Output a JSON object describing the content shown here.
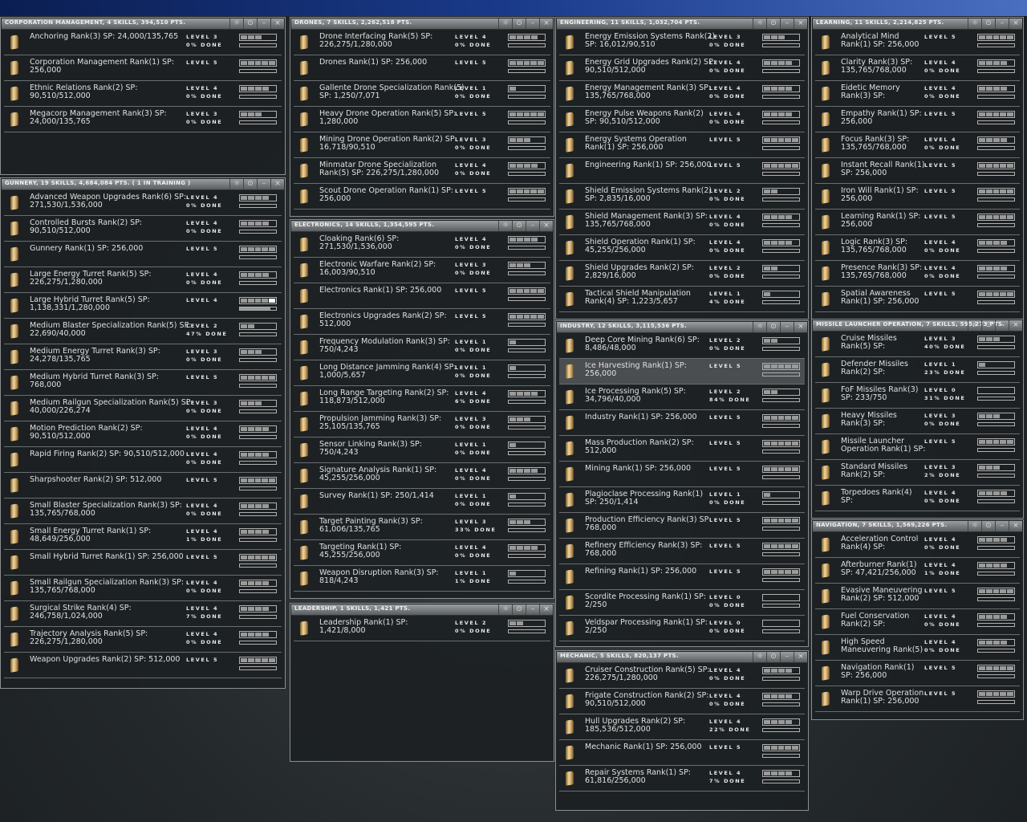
{
  "windows": [
    {
      "id": "corporation-management",
      "title": "CORPORATION MANAGEMENT, 4 SKILLS, 394,510 PTS.",
      "skills": [
        {
          "n": "Anchoring Rank(3) SP: 24,000/135,765",
          "s": "",
          "l": "LEVEL 3",
          "d": "0% DONE",
          "v": 3
        },
        {
          "n": "Corporation Management Rank(1) SP:",
          "s": "256,000",
          "l": "LEVEL 5",
          "d": "",
          "v": 5
        },
        {
          "n": "Ethnic Relations Rank(2) SP:",
          "s": "90,510/512,000",
          "l": "LEVEL 4",
          "d": "0% DONE",
          "v": 4
        },
        {
          "n": "Megacorp Management Rank(3) SP:",
          "s": "24,000/135,765",
          "l": "LEVEL 3",
          "d": "0% DONE",
          "v": 3
        }
      ]
    },
    {
      "id": "gunnery",
      "title": "GUNNERY, 19 SKILLS, 4,684,084 PTS. ( 1 IN TRAINING )",
      "skills": [
        {
          "n": "Advanced Weapon Upgrades Rank(6) SP:",
          "s": "271,530/1,536,000",
          "l": "LEVEL 4",
          "d": "0% DONE",
          "v": 4
        },
        {
          "n": "Controlled Bursts Rank(2) SP:",
          "s": "90,510/512,000",
          "l": "LEVEL 4",
          "d": "0% DONE",
          "v": 4
        },
        {
          "n": "Gunnery Rank(1) SP: 256,000",
          "s": "",
          "l": "LEVEL 5",
          "d": "",
          "v": 5
        },
        {
          "n": "Large Energy Turret Rank(5) SP:",
          "s": "226,275/1,280,000",
          "l": "LEVEL 4",
          "d": "0% DONE",
          "v": 4
        },
        {
          "n": "Large Hybrid Turret Rank(5) SP:",
          "s": "1,138,331/1,280,000",
          "l": "LEVEL 4",
          "d": "",
          "v": 4,
          "training": true,
          "progress": 0.85
        },
        {
          "n": "Medium Blaster Specialization Rank(5) SP:",
          "s": "22,690/40,000",
          "l": "LEVEL 2",
          "d": "47% DONE",
          "v": 2
        },
        {
          "n": "Medium Energy Turret Rank(3) SP:",
          "s": "24,278/135,765",
          "l": "LEVEL 3",
          "d": "0% DONE",
          "v": 3
        },
        {
          "n": "Medium Hybrid Turret Rank(3) SP:",
          "s": "768,000",
          "l": "LEVEL 5",
          "d": "",
          "v": 5
        },
        {
          "n": "Medium Railgun Specialization Rank(5) SP:",
          "s": "40,000/226,274",
          "l": "LEVEL 3",
          "d": "0% DONE",
          "v": 3
        },
        {
          "n": "Motion Prediction Rank(2) SP:",
          "s": "90,510/512,000",
          "l": "LEVEL 4",
          "d": "0% DONE",
          "v": 4
        },
        {
          "n": "Rapid Firing Rank(2) SP: 90,510/512,000",
          "s": "",
          "l": "LEVEL 4",
          "d": "0% DONE",
          "v": 4
        },
        {
          "n": "Sharpshooter Rank(2) SP: 512,000",
          "s": "",
          "l": "LEVEL 5",
          "d": "",
          "v": 5
        },
        {
          "n": "Small Blaster Specialization Rank(3) SP:",
          "s": "135,765/768,000",
          "l": "LEVEL 4",
          "d": "0% DONE",
          "v": 4
        },
        {
          "n": "Small Energy Turret Rank(1) SP:",
          "s": "48,649/256,000",
          "l": "LEVEL 4",
          "d": "1% DONE",
          "v": 4
        },
        {
          "n": "Small Hybrid Turret Rank(1) SP: 256,000",
          "s": "",
          "l": "LEVEL 5",
          "d": "",
          "v": 5
        },
        {
          "n": "Small Railgun Specialization Rank(3) SP:",
          "s": "135,765/768,000",
          "l": "LEVEL 4",
          "d": "0% DONE",
          "v": 4
        },
        {
          "n": "Surgical Strike Rank(4) SP:",
          "s": "246,758/1,024,000",
          "l": "LEVEL 4",
          "d": "7% DONE",
          "v": 4
        },
        {
          "n": "Trajectory Analysis Rank(5) SP:",
          "s": "226,275/1,280,000",
          "l": "LEVEL 4",
          "d": "0% DONE",
          "v": 4
        },
        {
          "n": "Weapon Upgrades Rank(2) SP: 512,000",
          "s": "",
          "l": "LEVEL 5",
          "d": "",
          "v": 5
        }
      ]
    },
    {
      "id": "drones",
      "title": "DRONES, 7 SKILLS, 2,262,518 PTS.",
      "skills": [
        {
          "n": "Drone Interfacing Rank(5) SP:",
          "s": "226,275/1,280,000",
          "l": "LEVEL 4",
          "d": "0% DONE",
          "v": 4
        },
        {
          "n": "Drones Rank(1) SP: 256,000",
          "s": "",
          "l": "LEVEL 5",
          "d": "",
          "v": 5
        },
        {
          "n": "Gallente Drone Specialization Rank(5)",
          "s": "SP: 1,250/7,071",
          "l": "LEVEL 1",
          "d": "0% DONE",
          "v": 1
        },
        {
          "n": "Heavy Drone Operation Rank(5) SP:",
          "s": "1,280,000",
          "l": "LEVEL 5",
          "d": "",
          "v": 5
        },
        {
          "n": "Mining Drone Operation Rank(2) SP:",
          "s": "16,718/90,510",
          "l": "LEVEL 3",
          "d": "0% DONE",
          "v": 3
        },
        {
          "n": "Minmatar Drone Specialization",
          "s": "Rank(5) SP: 226,275/1,280,000",
          "l": "LEVEL 4",
          "d": "0% DONE",
          "v": 4
        },
        {
          "n": "Scout Drone Operation Rank(1) SP:",
          "s": "256,000",
          "l": "LEVEL 5",
          "d": "",
          "v": 5
        }
      ]
    },
    {
      "id": "electronics",
      "title": "ELECTRONICS, 14 SKILLS, 1,354,595 PTS.",
      "skills": [
        {
          "n": "Cloaking Rank(6) SP:",
          "s": "271,530/1,536,000",
          "l": "LEVEL 4",
          "d": "0% DONE",
          "v": 4
        },
        {
          "n": "Electronic Warfare Rank(2) SP:",
          "s": "16,003/90,510",
          "l": "LEVEL 3",
          "d": "0% DONE",
          "v": 3
        },
        {
          "n": "Electronics Rank(1) SP: 256,000",
          "s": "",
          "l": "LEVEL 5",
          "d": "",
          "v": 5
        },
        {
          "n": "Electronics Upgrades Rank(2) SP:",
          "s": "512,000",
          "l": "LEVEL 5",
          "d": "",
          "v": 5
        },
        {
          "n": "Frequency Modulation Rank(3) SP:",
          "s": "750/4,243",
          "l": "LEVEL 1",
          "d": "0% DONE",
          "v": 1
        },
        {
          "n": "Long Distance Jamming Rank(4) SP:",
          "s": "1,000/5,657",
          "l": "LEVEL 1",
          "d": "0% DONE",
          "v": 1
        },
        {
          "n": "Long Range Targeting Rank(2) SP:",
          "s": "118,873/512,000",
          "l": "LEVEL 4",
          "d": "6% DONE",
          "v": 4
        },
        {
          "n": "Propulsion Jamming Rank(3) SP:",
          "s": "25,105/135,765",
          "l": "LEVEL 3",
          "d": "0% DONE",
          "v": 3
        },
        {
          "n": "Sensor Linking Rank(3) SP:",
          "s": "750/4,243",
          "l": "LEVEL 1",
          "d": "0% DONE",
          "v": 1
        },
        {
          "n": "Signature Analysis Rank(1) SP:",
          "s": "45,255/256,000",
          "l": "LEVEL 4",
          "d": "0% DONE",
          "v": 4
        },
        {
          "n": "Survey Rank(1) SP: 250/1,414",
          "s": "",
          "l": "LEVEL 1",
          "d": "0% DONE",
          "v": 1
        },
        {
          "n": "Target Painting Rank(3) SP:",
          "s": "61,006/135,765",
          "l": "LEVEL 3",
          "d": "33% DONE",
          "v": 3
        },
        {
          "n": "Targeting Rank(1) SP:",
          "s": "45,255/256,000",
          "l": "LEVEL 4",
          "d": "0% DONE",
          "v": 4
        },
        {
          "n": "Weapon Disruption Rank(3) SP:",
          "s": "818/4,243",
          "l": "LEVEL 1",
          "d": "1% DONE",
          "v": 1
        }
      ]
    },
    {
      "id": "leadership",
      "title": "LEADERSHIP, 1 SKILLS, 1,421 PTS.",
      "skills": [
        {
          "n": "Leadership Rank(1) SP:",
          "s": "1,421/8,000",
          "l": "LEVEL 2",
          "d": "0% DONE",
          "v": 2
        }
      ]
    },
    {
      "id": "engineering",
      "title": "ENGINEERING, 11 SKILLS, 1,032,704 PTS.",
      "skills": [
        {
          "n": "Energy Emission Systems Rank(2)",
          "s": "SP: 16,012/90,510",
          "l": "LEVEL 3",
          "d": "0% DONE",
          "v": 3
        },
        {
          "n": "Energy Grid Upgrades Rank(2) SP:",
          "s": "90,510/512,000",
          "l": "LEVEL 4",
          "d": "0% DONE",
          "v": 4
        },
        {
          "n": "Energy Management Rank(3) SP:",
          "s": "135,765/768,000",
          "l": "LEVEL 4",
          "d": "0% DONE",
          "v": 4
        },
        {
          "n": "Energy Pulse Weapons Rank(2)",
          "s": "SP: 90,510/512,000",
          "l": "LEVEL 4",
          "d": "0% DONE",
          "v": 4
        },
        {
          "n": "Energy Systems Operation",
          "s": "Rank(1) SP: 256,000",
          "l": "LEVEL 5",
          "d": "",
          "v": 5
        },
        {
          "n": "Engineering Rank(1) SP: 256,000",
          "s": "",
          "l": "LEVEL 5",
          "d": "",
          "v": 5
        },
        {
          "n": "Shield Emission Systems Rank(2)",
          "s": "SP: 2,835/16,000",
          "l": "LEVEL 2",
          "d": "0% DONE",
          "v": 2
        },
        {
          "n": "Shield Management Rank(3) SP:",
          "s": "135,765/768,000",
          "l": "LEVEL 4",
          "d": "0% DONE",
          "v": 4
        },
        {
          "n": "Shield Operation Rank(1) SP:",
          "s": "45,255/256,000",
          "l": "LEVEL 4",
          "d": "0% DONE",
          "v": 4
        },
        {
          "n": "Shield Upgrades Rank(2) SP:",
          "s": "2,829/16,000",
          "l": "LEVEL 2",
          "d": "0% DONE",
          "v": 2
        },
        {
          "n": "Tactical Shield Manipulation",
          "s": "Rank(4) SP: 1,223/5,657",
          "l": "LEVEL 1",
          "d": "4% DONE",
          "v": 1
        }
      ]
    },
    {
      "id": "industry",
      "title": "INDUSTRY, 12 SKILLS, 3,115,536 PTS.",
      "skills": [
        {
          "n": "Deep Core Mining Rank(6) SP:",
          "s": "8,486/48,000",
          "l": "LEVEL 2",
          "d": "0% DONE",
          "v": 2
        },
        {
          "n": "Ice Harvesting Rank(1) SP:",
          "s": "256,000",
          "l": "LEVEL 5",
          "d": "",
          "v": 5,
          "selected": true
        },
        {
          "n": "Ice Processing Rank(5) SP:",
          "s": "34,796/40,000",
          "l": "LEVEL 2",
          "d": "84% DONE",
          "v": 2
        },
        {
          "n": "Industry Rank(1) SP: 256,000",
          "s": "",
          "l": "LEVEL 5",
          "d": "",
          "v": 5
        },
        {
          "n": "Mass Production Rank(2) SP:",
          "s": "512,000",
          "l": "LEVEL 5",
          "d": "",
          "v": 5
        },
        {
          "n": "Mining Rank(1) SP: 256,000",
          "s": "",
          "l": "LEVEL 5",
          "d": "",
          "v": 5
        },
        {
          "n": "Plagioclase Processing Rank(1)",
          "s": "SP: 250/1,414",
          "l": "LEVEL 1",
          "d": "0% DONE",
          "v": 1
        },
        {
          "n": "Production Efficiency Rank(3) SP:",
          "s": "768,000",
          "l": "LEVEL 5",
          "d": "",
          "v": 5
        },
        {
          "n": "Refinery Efficiency Rank(3) SP:",
          "s": "768,000",
          "l": "LEVEL 5",
          "d": "",
          "v": 5
        },
        {
          "n": "Refining Rank(1) SP: 256,000",
          "s": "",
          "l": "LEVEL 5",
          "d": "",
          "v": 5
        },
        {
          "n": "Scordite Processing Rank(1) SP:",
          "s": "2/250",
          "l": "LEVEL 0",
          "d": "0% DONE",
          "v": 0
        },
        {
          "n": "Veldspar Processing Rank(1) SP:",
          "s": "2/250",
          "l": "LEVEL 0",
          "d": "0% DONE",
          "v": 0
        }
      ]
    },
    {
      "id": "mechanic",
      "title": "MECHANIC, 5 SKILLS, 820,137 PTS.",
      "skills": [
        {
          "n": "Cruiser Construction Rank(5) SP:",
          "s": "226,275/1,280,000",
          "l": "LEVEL 4",
          "d": "0% DONE",
          "v": 4
        },
        {
          "n": "Frigate Construction Rank(2) SP:",
          "s": "90,510/512,000",
          "l": "LEVEL 4",
          "d": "0% DONE",
          "v": 4
        },
        {
          "n": "Hull Upgrades Rank(2) SP:",
          "s": "185,536/512,000",
          "l": "LEVEL 4",
          "d": "22% DONE",
          "v": 4
        },
        {
          "n": "Mechanic Rank(1) SP: 256,000",
          "s": "",
          "l": "LEVEL 5",
          "d": "",
          "v": 5
        },
        {
          "n": "Repair Systems Rank(1) SP:",
          "s": "61,816/256,000",
          "l": "LEVEL 4",
          "d": "7% DONE",
          "v": 4
        }
      ]
    },
    {
      "id": "learning",
      "title": "LEARNING, 11 SKILLS, 2,214,825 PTS.",
      "skills": [
        {
          "n": "Analytical Mind",
          "s": "Rank(1) SP: 256,000",
          "l": "LEVEL 5",
          "d": "",
          "v": 5
        },
        {
          "n": "Clarity Rank(3) SP:",
          "s": "135,765/768,000",
          "l": "LEVEL 4",
          "d": "0% DONE",
          "v": 4
        },
        {
          "n": "Eidetic Memory",
          "s": "Rank(3) SP:",
          "l": "LEVEL 4",
          "d": "0% DONE",
          "v": 4
        },
        {
          "n": "Empathy Rank(1) SP:",
          "s": "256,000",
          "l": "LEVEL 5",
          "d": "",
          "v": 5
        },
        {
          "n": "Focus Rank(3) SP:",
          "s": "135,765/768,000",
          "l": "LEVEL 4",
          "d": "0% DONE",
          "v": 4
        },
        {
          "n": "Instant Recall Rank(1)",
          "s": "SP: 256,000",
          "l": "LEVEL 5",
          "d": "",
          "v": 5
        },
        {
          "n": "Iron Will Rank(1) SP:",
          "s": "256,000",
          "l": "LEVEL 5",
          "d": "",
          "v": 5
        },
        {
          "n": "Learning Rank(1) SP:",
          "s": "256,000",
          "l": "LEVEL 5",
          "d": "",
          "v": 5
        },
        {
          "n": "Logic Rank(3) SP:",
          "s": "135,765/768,000",
          "l": "LEVEL 4",
          "d": "0% DONE",
          "v": 4
        },
        {
          "n": "Presence Rank(3) SP:",
          "s": "135,765/768,000",
          "l": "LEVEL 4",
          "d": "0% DONE",
          "v": 4
        },
        {
          "n": "Spatial Awareness",
          "s": "Rank(1) SP: 256,000",
          "l": "LEVEL 5",
          "d": "",
          "v": 5
        }
      ]
    },
    {
      "id": "missile-launcher-operation",
      "title": "MISSILE LAUNCHER OPERATION, 7 SKILLS, 595,273 PTS.",
      "skills": [
        {
          "n": "Cruise Missiles",
          "s": "Rank(5) SP:",
          "l": "LEVEL 3",
          "d": "40% DONE",
          "v": 3
        },
        {
          "n": "Defender Missiles",
          "s": "Rank(2) SP:",
          "l": "LEVEL 1",
          "d": "23% DONE",
          "v": 1
        },
        {
          "n": "FoF Missiles Rank(3)",
          "s": "SP: 233/750",
          "l": "LEVEL 0",
          "d": "31% DONE",
          "v": 0
        },
        {
          "n": "Heavy Missiles",
          "s": "Rank(3) SP:",
          "l": "LEVEL 3",
          "d": "0% DONE",
          "v": 3
        },
        {
          "n": "Missile Launcher",
          "s": "Operation Rank(1) SP:",
          "l": "LEVEL 5",
          "d": "",
          "v": 5
        },
        {
          "n": "Standard Missiles",
          "s": "Rank(2) SP:",
          "l": "LEVEL 3",
          "d": "2% DONE",
          "v": 3
        },
        {
          "n": "Torpedoes Rank(4)",
          "s": "SP:",
          "l": "LEVEL 4",
          "d": "0% DONE",
          "v": 4
        }
      ]
    },
    {
      "id": "navigation",
      "title": "NAVIGATION, 7 SKILLS, 1,569,226 PTS.",
      "skills": [
        {
          "n": "Acceleration Control",
          "s": "Rank(4) SP:",
          "l": "LEVEL 4",
          "d": "0% DONE",
          "v": 4
        },
        {
          "n": "Afterburner Rank(1)",
          "s": "SP: 47,421/256,000",
          "l": "LEVEL 4",
          "d": "1% DONE",
          "v": 4
        },
        {
          "n": "Evasive Maneuvering",
          "s": "Rank(2) SP: 512,000",
          "l": "LEVEL 5",
          "d": "",
          "v": 5
        },
        {
          "n": "Fuel Conservation",
          "s": "Rank(2) SP:",
          "l": "LEVEL 4",
          "d": "0% DONE",
          "v": 4
        },
        {
          "n": "High Speed",
          "s": "Maneuvering Rank(5)",
          "l": "LEVEL 4",
          "d": "0% DONE",
          "v": 4
        },
        {
          "n": "Navigation Rank(1)",
          "s": "SP: 256,000",
          "l": "LEVEL 5",
          "d": "",
          "v": 5
        },
        {
          "n": "Warp Drive Operation",
          "s": "Rank(1) SP: 256,000",
          "l": "LEVEL 5",
          "d": "",
          "v": 5
        }
      ]
    }
  ],
  "window_buttons": {
    "pin": "☼",
    "options": "⊙",
    "minimize": "–",
    "close": "×"
  }
}
